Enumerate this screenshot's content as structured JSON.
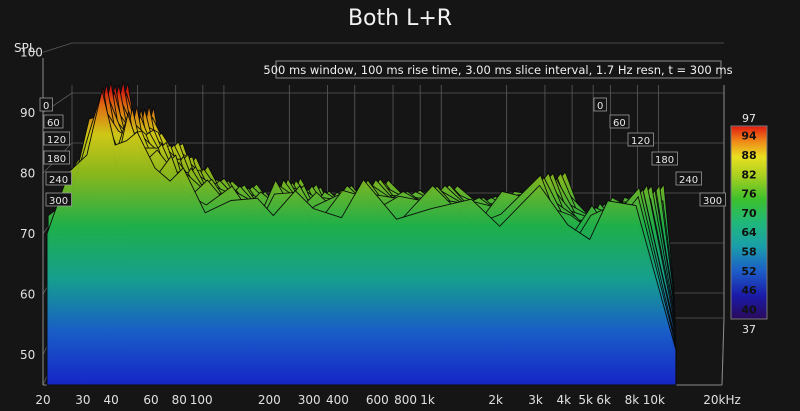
{
  "chart_data": {
    "type": "waterfall",
    "title": "Both L+R",
    "ylabel": "SPL",
    "info": "500 ms window, 100 ms rise time, 3.00 ms slice interval, 1.7 Hz resn, t = 300 ms",
    "xaxis": {
      "scale": "log",
      "range": [
        20,
        20000
      ],
      "ticks": [
        {
          "v": 20,
          "label": "20"
        },
        {
          "v": 30,
          "label": "30"
        },
        {
          "v": 40,
          "label": "40"
        },
        {
          "v": 60,
          "label": "60"
        },
        {
          "v": 80,
          "label": "80"
        },
        {
          "v": 100,
          "label": "100"
        },
        {
          "v": 200,
          "label": "200"
        },
        {
          "v": 300,
          "label": "300"
        },
        {
          "v": 400,
          "label": "400"
        },
        {
          "v": 600,
          "label": "600"
        },
        {
          "v": 800,
          "label": "800"
        },
        {
          "v": 1000,
          "label": "1k"
        },
        {
          "v": 2000,
          "label": "2k"
        },
        {
          "v": 3000,
          "label": "3k"
        },
        {
          "v": 4000,
          "label": "4k"
        },
        {
          "v": 5000,
          "label": "5k"
        },
        {
          "v": 6000,
          "label": "6k"
        },
        {
          "v": 8000,
          "label": "8k"
        },
        {
          "v": 10000,
          "label": "10k"
        },
        {
          "v": 20000,
          "label": "20kHz"
        }
      ]
    },
    "yaxis": {
      "range": [
        45,
        100
      ],
      "ticks": [
        50,
        60,
        70,
        80,
        90,
        100
      ]
    },
    "time_axis": {
      "unit": "ms",
      "ticks": [
        0,
        60,
        120,
        180,
        240,
        300
      ]
    },
    "colorbar": {
      "min": 37,
      "max": 97,
      "labels": [
        94,
        88,
        82,
        76,
        70,
        64,
        58,
        52,
        46,
        40
      ]
    },
    "front_slice": {
      "x": [
        20,
        25,
        30,
        35,
        40,
        45,
        50,
        60,
        70,
        80,
        100,
        130,
        170,
        200,
        250,
        300,
        400,
        500,
        700,
        1000,
        1500,
        2000,
        3000,
        4000,
        5000,
        6000,
        8000
      ],
      "y": [
        70,
        78,
        86,
        92,
        84,
        88,
        84,
        82,
        80,
        78,
        76,
        75,
        74,
        76,
        75,
        74,
        75,
        76,
        74,
        75,
        73,
        74,
        77,
        70,
        72,
        73,
        75
      ]
    }
  },
  "colors": {
    "background": "#151515",
    "grid": "#5a5a5a",
    "text": "#e0e0e0"
  }
}
